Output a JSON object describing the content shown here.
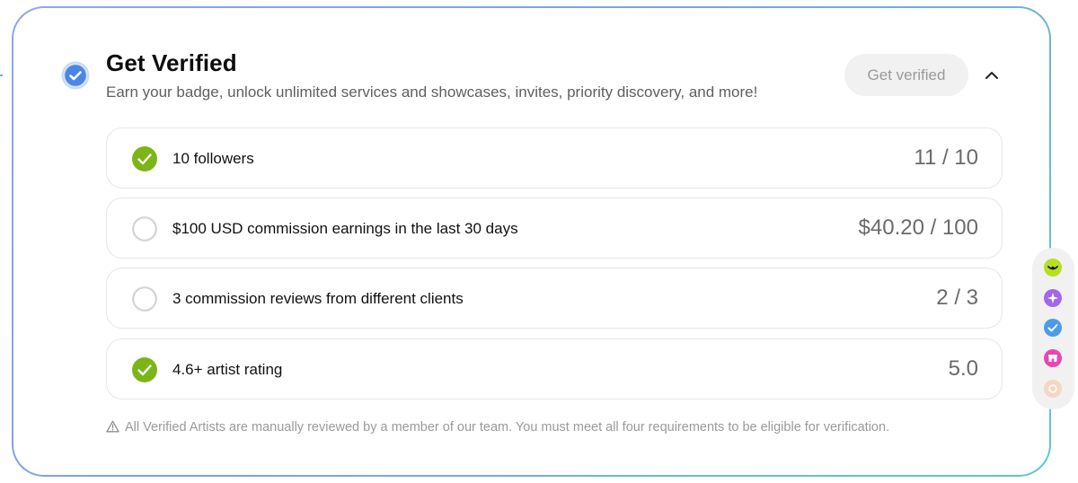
{
  "card": {
    "title": "Get Verified",
    "subtitle": "Earn your badge, unlock unlimited services and showcases, invites, priority discovery, and more!",
    "badge_icon": "verified-badge-icon",
    "get_verified_button": "Get verified",
    "collapse_icon": "chevron-up-icon"
  },
  "requirements": [
    {
      "label": "10 followers",
      "progress": "11 / 10",
      "met": true
    },
    {
      "label": "$100 USD commission earnings in the last 30 days",
      "progress": "$40.20 / 100",
      "met": false
    },
    {
      "label": "3 commission reviews from different clients",
      "progress": "2 / 3",
      "met": false
    },
    {
      "label": "4.6+ artist rating",
      "progress": "5.0",
      "met": true
    }
  ],
  "note": "All Verified Artists are manually reviewed by a member of our team. You must meet all four requirements to be eligible for verification.",
  "side_rail": [
    {
      "icon": "lime-face-icon",
      "color": "#b6e01f"
    },
    {
      "icon": "purple-sparkle-icon",
      "color": "#a267ea"
    },
    {
      "icon": "blue-check-icon",
      "color": "#4c9ce8"
    },
    {
      "icon": "pink-shop-icon",
      "color": "#e845b5"
    },
    {
      "icon": "faded-coin-icon",
      "color": "#f6d6c4"
    }
  ],
  "colors": {
    "success": "#7cb518",
    "muted_text": "#5f5f5f",
    "border_gradient": [
      "#8fa7e6",
      "#5fc9c9"
    ]
  }
}
